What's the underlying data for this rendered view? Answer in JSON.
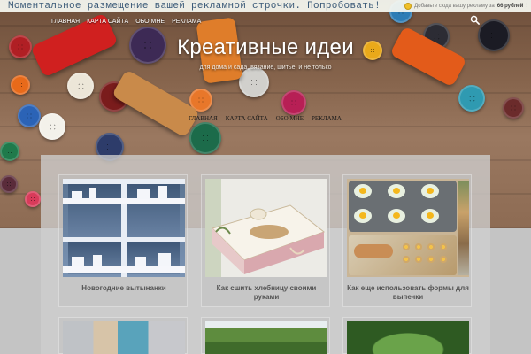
{
  "promo": {
    "text": "Моментальное размещение вашей рекламной строчки. Попробовать!",
    "offer_prefix": "Добавьте сюда вашу рекламу за",
    "offer_price": "66 рублей",
    "offer_suffix": "!"
  },
  "top_nav": {
    "items": [
      "ГЛАВНАЯ",
      "КАРТА САЙТА",
      "ОБО МНЕ",
      "РЕКЛАМА"
    ]
  },
  "site": {
    "title": "Креативные идеи",
    "tagline": "для дома и сада, вязание, шитье, и не только"
  },
  "mid_nav": {
    "items": [
      "ГЛАВНАЯ",
      "КАРТА САЙТА",
      "ОБО МНЕ",
      "РЕКЛАМА"
    ]
  },
  "posts": [
    {
      "title": "Новогодние вытынанки"
    },
    {
      "title": "Как сшить хлебницу своими руками"
    },
    {
      "title": "Как еще использовать формы для выпечки"
    }
  ],
  "icons": {
    "search": "search-icon"
  },
  "colors": {
    "promo_link": "#3b5a78",
    "nav_text": "#ffffff",
    "content_bg": "#cecece",
    "card_title": "#555555"
  }
}
